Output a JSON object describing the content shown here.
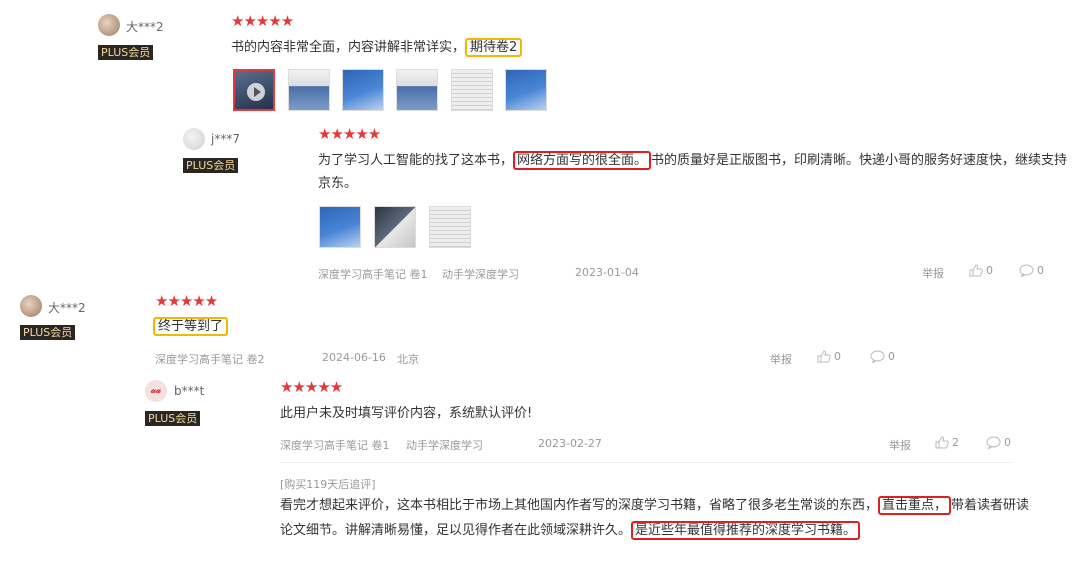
{
  "reviews": [
    {
      "user": "大***2",
      "badge": "PLUS会员",
      "stars": "★★★★★",
      "text_before": "书的内容非常全面，内容讲解非常详实，",
      "text_highlight": "期待卷2",
      "thumbs": [
        "video",
        "book",
        "blue",
        "book",
        "paper",
        "blue"
      ]
    },
    {
      "user": "j***7",
      "badge": "PLUS会员",
      "stars": "★★★★★",
      "line1_before": "为了学习人工智能的找了这本书，",
      "line1_highlight": "网络方面写的很全面。",
      "line1_after": "书的质量好是正版图书，印刷清晰。快递小哥的服务好速度快，继续支持",
      "line2": "京东。",
      "thumbs": [
        "blue",
        "dark",
        "paper"
      ],
      "product": "深度学习高手笔记 卷1",
      "variant": "动手学深度学习",
      "date": "2023-01-04",
      "report": "举报",
      "likes": "0",
      "comments": "0"
    },
    {
      "user": "大***2",
      "badge": "PLUS会员",
      "stars": "★★★★★",
      "text_highlight": "终于等到了",
      "product": "深度学习高手笔记 卷2",
      "date": "2024-06-16",
      "location": "北京",
      "report": "举报",
      "likes": "0",
      "comments": "0"
    },
    {
      "user": "b***t",
      "avatar_text": "𝒶𝒶",
      "badge": "PLUS会员",
      "stars": "★★★★★",
      "text": "此用户未及时填写评价内容，系统默认评价!",
      "product": "深度学习高手笔记 卷1",
      "variant": "动手学深度学习",
      "date": "2023-02-27",
      "report": "举报",
      "likes": "2",
      "comments": "0",
      "followup_label": "[购买119天后追评]",
      "fu_line1_before": "看完才想起来评价，这本书相比于市场上其他国内作者写的深度学习书籍，省略了很多老生常谈的东西，",
      "fu_line1_highlight": "直击重点，",
      "fu_line1_after": "带着读者研读",
      "fu_line2_before": "论文细节。讲解清晰易懂，足以见得作者在此领域深耕许久。",
      "fu_line2_highlight": "是近些年最值得推荐的深度学习书籍。"
    }
  ],
  "colors": {
    "star": "#e4393c",
    "highlight_yellow": "#f5b800",
    "highlight_red": "#e02020",
    "plus_bg": "#2b2621",
    "plus_text": "#f2d9a0"
  }
}
